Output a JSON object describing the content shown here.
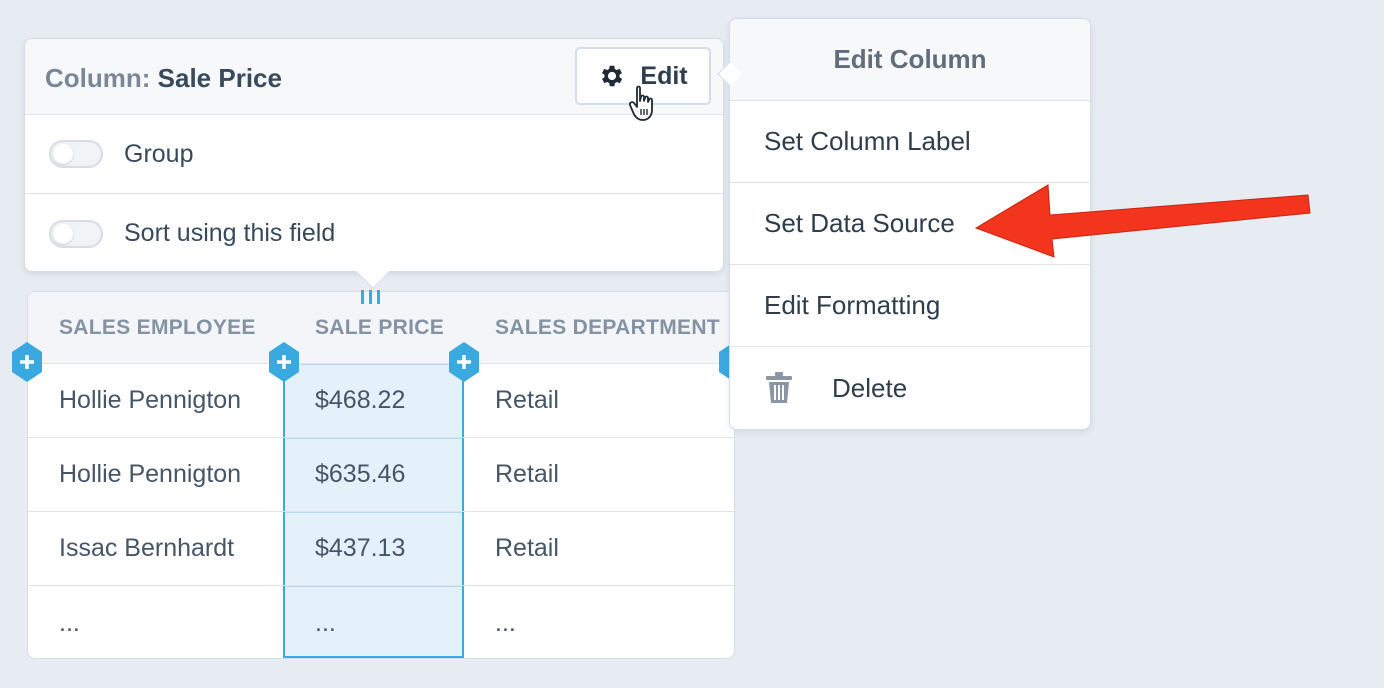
{
  "column_popover": {
    "title_label": "Column:",
    "title_value": "Sale Price",
    "edit_button_label": "Edit",
    "toggles": [
      {
        "label": "Group",
        "on": false
      },
      {
        "label": "Sort using this field",
        "on": false
      }
    ]
  },
  "table": {
    "headers": [
      "SALES EMPLOYEE",
      "SALE PRICE",
      "SALES DEPARTMENT"
    ],
    "rows": [
      [
        "Hollie Pennigton",
        "$468.22",
        "Retail"
      ],
      [
        "Hollie Pennigton",
        "$635.46",
        "Retail"
      ],
      [
        "Issac Bernhardt",
        "$437.13",
        "Retail"
      ],
      [
        "...",
        "...",
        "..."
      ]
    ],
    "selected_column": "SALE PRICE"
  },
  "edit_menu": {
    "title": "Edit Column",
    "items": [
      "Set Column Label",
      "Set Data Source",
      "Edit Formatting",
      "Delete"
    ]
  },
  "colors": {
    "accent": "#39a9e0",
    "annotation_arrow": "#f2351c",
    "background": "#e7ebf2"
  },
  "icons": [
    "gear-icon",
    "hand-cursor-icon",
    "trash-icon",
    "plus-icon",
    "drag-handle-icon",
    "arrow-annotation"
  ]
}
